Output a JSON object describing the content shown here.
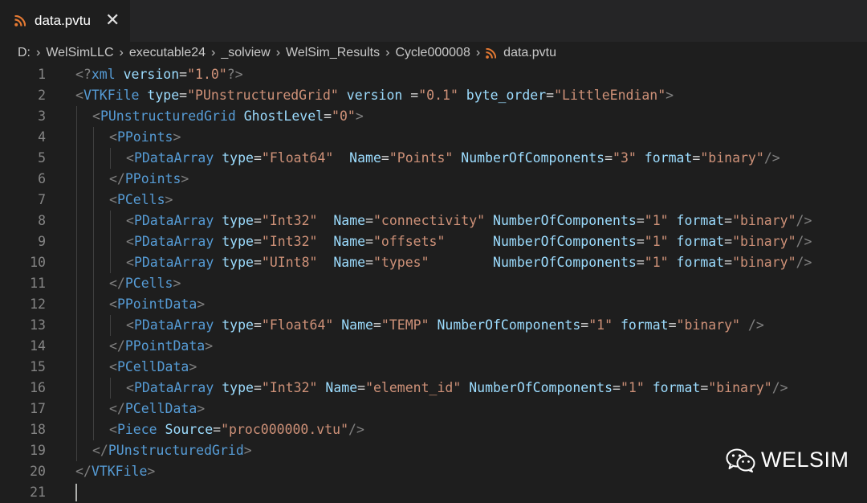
{
  "tab": {
    "label": "data.pvtu",
    "close_glyph": "✕",
    "icon": "rss-icon",
    "icon_color": "#e37933"
  },
  "breadcrumb": {
    "segments": [
      "D:",
      "WelSimLLC",
      "executable24",
      "_solview",
      "WelSim_Results",
      "Cycle000008",
      "data.pvtu"
    ],
    "separator": "›"
  },
  "editor": {
    "lines": [
      {
        "n": "1",
        "indent": 0,
        "tokens": [
          [
            "punct",
            "<?"
          ],
          [
            "tag",
            "xml "
          ],
          [
            "attr",
            "version"
          ],
          [
            "eq",
            "="
          ],
          [
            "str",
            "\"1.0\""
          ],
          [
            "punct",
            "?>"
          ]
        ]
      },
      {
        "n": "2",
        "indent": 0,
        "tokens": [
          [
            "punct",
            "<"
          ],
          [
            "tag",
            "VTKFile "
          ],
          [
            "attr",
            "type"
          ],
          [
            "eq",
            "="
          ],
          [
            "str",
            "\"PUnstructuredGrid\""
          ],
          [
            "attr",
            " version "
          ],
          [
            "eq",
            "="
          ],
          [
            "str",
            "\"0.1\""
          ],
          [
            "attr",
            " byte_order"
          ],
          [
            "eq",
            "="
          ],
          [
            "str",
            "\"LittleEndian\""
          ],
          [
            "punct",
            ">"
          ]
        ]
      },
      {
        "n": "3",
        "indent": 1,
        "tokens": [
          [
            "punct",
            "<"
          ],
          [
            "tag",
            "PUnstructuredGrid "
          ],
          [
            "attr",
            "GhostLevel"
          ],
          [
            "eq",
            "="
          ],
          [
            "str",
            "\"0\""
          ],
          [
            "punct",
            ">"
          ]
        ]
      },
      {
        "n": "4",
        "indent": 2,
        "tokens": [
          [
            "punct",
            "<"
          ],
          [
            "tag",
            "PPoints"
          ],
          [
            "punct",
            ">"
          ]
        ]
      },
      {
        "n": "5",
        "indent": 3,
        "tokens": [
          [
            "punct",
            "<"
          ],
          [
            "tag",
            "PDataArray "
          ],
          [
            "attr",
            "type"
          ],
          [
            "eq",
            "="
          ],
          [
            "str",
            "\"Float64\""
          ],
          [
            "attr",
            "  Name"
          ],
          [
            "eq",
            "="
          ],
          [
            "str",
            "\"Points\""
          ],
          [
            "attr",
            " NumberOfComponents"
          ],
          [
            "eq",
            "="
          ],
          [
            "str",
            "\"3\""
          ],
          [
            "attr",
            " format"
          ],
          [
            "eq",
            "="
          ],
          [
            "str",
            "\"binary\""
          ],
          [
            "punct",
            "/>"
          ]
        ]
      },
      {
        "n": "6",
        "indent": 2,
        "tokens": [
          [
            "punct",
            "</"
          ],
          [
            "tag",
            "PPoints"
          ],
          [
            "punct",
            ">"
          ]
        ]
      },
      {
        "n": "7",
        "indent": 2,
        "tokens": [
          [
            "punct",
            "<"
          ],
          [
            "tag",
            "PCells"
          ],
          [
            "punct",
            ">"
          ]
        ]
      },
      {
        "n": "8",
        "indent": 3,
        "tokens": [
          [
            "punct",
            "<"
          ],
          [
            "tag",
            "PDataArray "
          ],
          [
            "attr",
            "type"
          ],
          [
            "eq",
            "="
          ],
          [
            "str",
            "\"Int32\""
          ],
          [
            "attr",
            "  Name"
          ],
          [
            "eq",
            "="
          ],
          [
            "str",
            "\"connectivity\""
          ],
          [
            "attr",
            " NumberOfComponents"
          ],
          [
            "eq",
            "="
          ],
          [
            "str",
            "\"1\""
          ],
          [
            "attr",
            " format"
          ],
          [
            "eq",
            "="
          ],
          [
            "str",
            "\"binary\""
          ],
          [
            "punct",
            "/>"
          ]
        ]
      },
      {
        "n": "9",
        "indent": 3,
        "tokens": [
          [
            "punct",
            "<"
          ],
          [
            "tag",
            "PDataArray "
          ],
          [
            "attr",
            "type"
          ],
          [
            "eq",
            "="
          ],
          [
            "str",
            "\"Int32\""
          ],
          [
            "attr",
            "  Name"
          ],
          [
            "eq",
            "="
          ],
          [
            "str",
            "\"offsets\""
          ],
          [
            "attr",
            "      NumberOfComponents"
          ],
          [
            "eq",
            "="
          ],
          [
            "str",
            "\"1\""
          ],
          [
            "attr",
            " format"
          ],
          [
            "eq",
            "="
          ],
          [
            "str",
            "\"binary\""
          ],
          [
            "punct",
            "/>"
          ]
        ]
      },
      {
        "n": "10",
        "indent": 3,
        "tokens": [
          [
            "punct",
            "<"
          ],
          [
            "tag",
            "PDataArray "
          ],
          [
            "attr",
            "type"
          ],
          [
            "eq",
            "="
          ],
          [
            "str",
            "\"UInt8\""
          ],
          [
            "attr",
            "  Name"
          ],
          [
            "eq",
            "="
          ],
          [
            "str",
            "\"types\""
          ],
          [
            "attr",
            "        NumberOfComponents"
          ],
          [
            "eq",
            "="
          ],
          [
            "str",
            "\"1\""
          ],
          [
            "attr",
            " format"
          ],
          [
            "eq",
            "="
          ],
          [
            "str",
            "\"binary\""
          ],
          [
            "punct",
            "/>"
          ]
        ]
      },
      {
        "n": "11",
        "indent": 2,
        "tokens": [
          [
            "punct",
            "</"
          ],
          [
            "tag",
            "PCells"
          ],
          [
            "punct",
            ">"
          ]
        ]
      },
      {
        "n": "12",
        "indent": 2,
        "tokens": [
          [
            "punct",
            "<"
          ],
          [
            "tag",
            "PPointData"
          ],
          [
            "punct",
            ">"
          ]
        ]
      },
      {
        "n": "13",
        "indent": 3,
        "tokens": [
          [
            "punct",
            "<"
          ],
          [
            "tag",
            "PDataArray "
          ],
          [
            "attr",
            "type"
          ],
          [
            "eq",
            "="
          ],
          [
            "str",
            "\"Float64\""
          ],
          [
            "attr",
            " Name"
          ],
          [
            "eq",
            "="
          ],
          [
            "str",
            "\"TEMP\""
          ],
          [
            "attr",
            " NumberOfComponents"
          ],
          [
            "eq",
            "="
          ],
          [
            "str",
            "\"1\""
          ],
          [
            "attr",
            " format"
          ],
          [
            "eq",
            "="
          ],
          [
            "str",
            "\"binary\""
          ],
          [
            "punct",
            " />"
          ]
        ]
      },
      {
        "n": "14",
        "indent": 2,
        "tokens": [
          [
            "punct",
            "</"
          ],
          [
            "tag",
            "PPointData"
          ],
          [
            "punct",
            ">"
          ]
        ]
      },
      {
        "n": "15",
        "indent": 2,
        "tokens": [
          [
            "punct",
            "<"
          ],
          [
            "tag",
            "PCellData"
          ],
          [
            "punct",
            ">"
          ]
        ]
      },
      {
        "n": "16",
        "indent": 3,
        "tokens": [
          [
            "punct",
            "<"
          ],
          [
            "tag",
            "PDataArray "
          ],
          [
            "attr",
            "type"
          ],
          [
            "eq",
            "="
          ],
          [
            "str",
            "\"Int32\""
          ],
          [
            "attr",
            " Name"
          ],
          [
            "eq",
            "="
          ],
          [
            "str",
            "\"element_id\""
          ],
          [
            "attr",
            " NumberOfComponents"
          ],
          [
            "eq",
            "="
          ],
          [
            "str",
            "\"1\""
          ],
          [
            "attr",
            " format"
          ],
          [
            "eq",
            "="
          ],
          [
            "str",
            "\"binary\""
          ],
          [
            "punct",
            "/>"
          ]
        ]
      },
      {
        "n": "17",
        "indent": 2,
        "tokens": [
          [
            "punct",
            "</"
          ],
          [
            "tag",
            "PCellData"
          ],
          [
            "punct",
            ">"
          ]
        ]
      },
      {
        "n": "18",
        "indent": 2,
        "tokens": [
          [
            "punct",
            "<"
          ],
          [
            "tag",
            "Piece "
          ],
          [
            "attr",
            "Source"
          ],
          [
            "eq",
            "="
          ],
          [
            "str",
            "\"proc000000.vtu\""
          ],
          [
            "punct",
            "/>"
          ]
        ]
      },
      {
        "n": "19",
        "indent": 1,
        "tokens": [
          [
            "punct",
            "</"
          ],
          [
            "tag",
            "PUnstructuredGrid"
          ],
          [
            "punct",
            ">"
          ]
        ]
      },
      {
        "n": "20",
        "indent": 0,
        "tokens": [
          [
            "punct",
            "</"
          ],
          [
            "tag",
            "VTKFile"
          ],
          [
            "punct",
            ">"
          ]
        ]
      },
      {
        "n": "21",
        "indent": 0,
        "tokens": []
      }
    ],
    "colors": {
      "punct": "#808080",
      "tag": "#569cd6",
      "attr": "#9cdcfe",
      "eq": "#d4d4d4",
      "str": "#ce9178"
    }
  },
  "watermark": {
    "text": "WELSIM",
    "icon": "wechat-icon"
  }
}
